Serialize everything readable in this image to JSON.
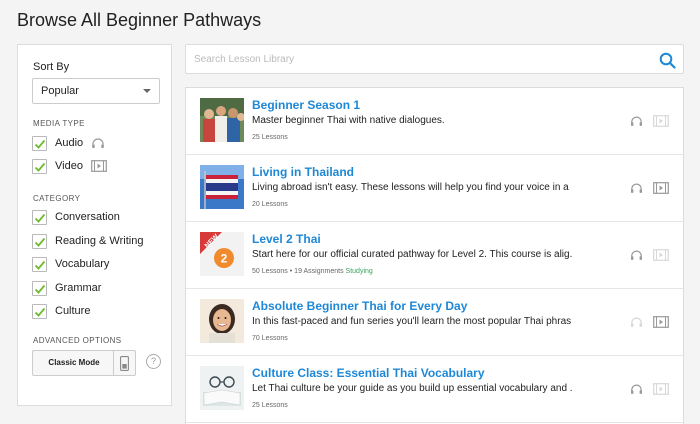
{
  "page": {
    "title": "Browse All Beginner Pathways"
  },
  "sidebar": {
    "sort_label": "Sort By",
    "sort_value": "Popular",
    "media_type_label": "MEDIA TYPE",
    "media": [
      {
        "label": "Audio",
        "checked": true
      },
      {
        "label": "Video",
        "checked": true
      }
    ],
    "category_label": "CATEGORY",
    "categories": [
      {
        "label": "Conversation",
        "checked": true
      },
      {
        "label": "Reading & Writing",
        "checked": true
      },
      {
        "label": "Vocabulary",
        "checked": true
      },
      {
        "label": "Grammar",
        "checked": true
      },
      {
        "label": "Culture",
        "checked": true
      }
    ],
    "advanced_label": "ADVANCED OPTIONS",
    "classic_mode_label": "Classic Mode",
    "help_glyph": "?"
  },
  "search": {
    "placeholder": "Search Lesson Library",
    "value": ""
  },
  "colors": {
    "link": "#1e88d6",
    "check": "#6dbb2d",
    "studying": "#3aa35a"
  },
  "pathways": [
    {
      "title": "Beginner Season 1",
      "description": "Master beginner Thai with native dialogues.",
      "lessons": "25 Lessons",
      "assignments": "",
      "status": "",
      "thumb": "group-photo",
      "audio_active": true,
      "video_active": false
    },
    {
      "title": "Living in Thailand",
      "description": "Living abroad isn't easy. These lessons will help you find your voice in a ...",
      "lessons": "20 Lessons",
      "assignments": "",
      "status": "",
      "thumb": "thai-flag",
      "audio_active": true,
      "video_active": true
    },
    {
      "title": "Level 2 Thai",
      "description": "Start here for our official curated pathway for Level 2. This course is alig...",
      "lessons": "50 Lessons",
      "assignments": "19 Assignments",
      "status": "Studying",
      "thumb": "level-2-badge",
      "badge_text": "NEW",
      "badge_number": "2",
      "audio_active": true,
      "video_active": false
    },
    {
      "title": "Absolute Beginner Thai for Every Day",
      "description": "In this fast-paced and fun series you'll learn the most popular Thai phras...",
      "lessons": "70 Lessons",
      "assignments": "",
      "status": "",
      "thumb": "woman-portrait",
      "audio_active": false,
      "video_active": true
    },
    {
      "title": "Culture Class: Essential Thai Vocabulary",
      "description": "Let Thai culture be your guide as you build up essential vocabulary and ...",
      "lessons": "25 Lessons",
      "assignments": "",
      "status": "",
      "thumb": "glasses-book",
      "audio_active": true,
      "video_active": false
    }
  ]
}
